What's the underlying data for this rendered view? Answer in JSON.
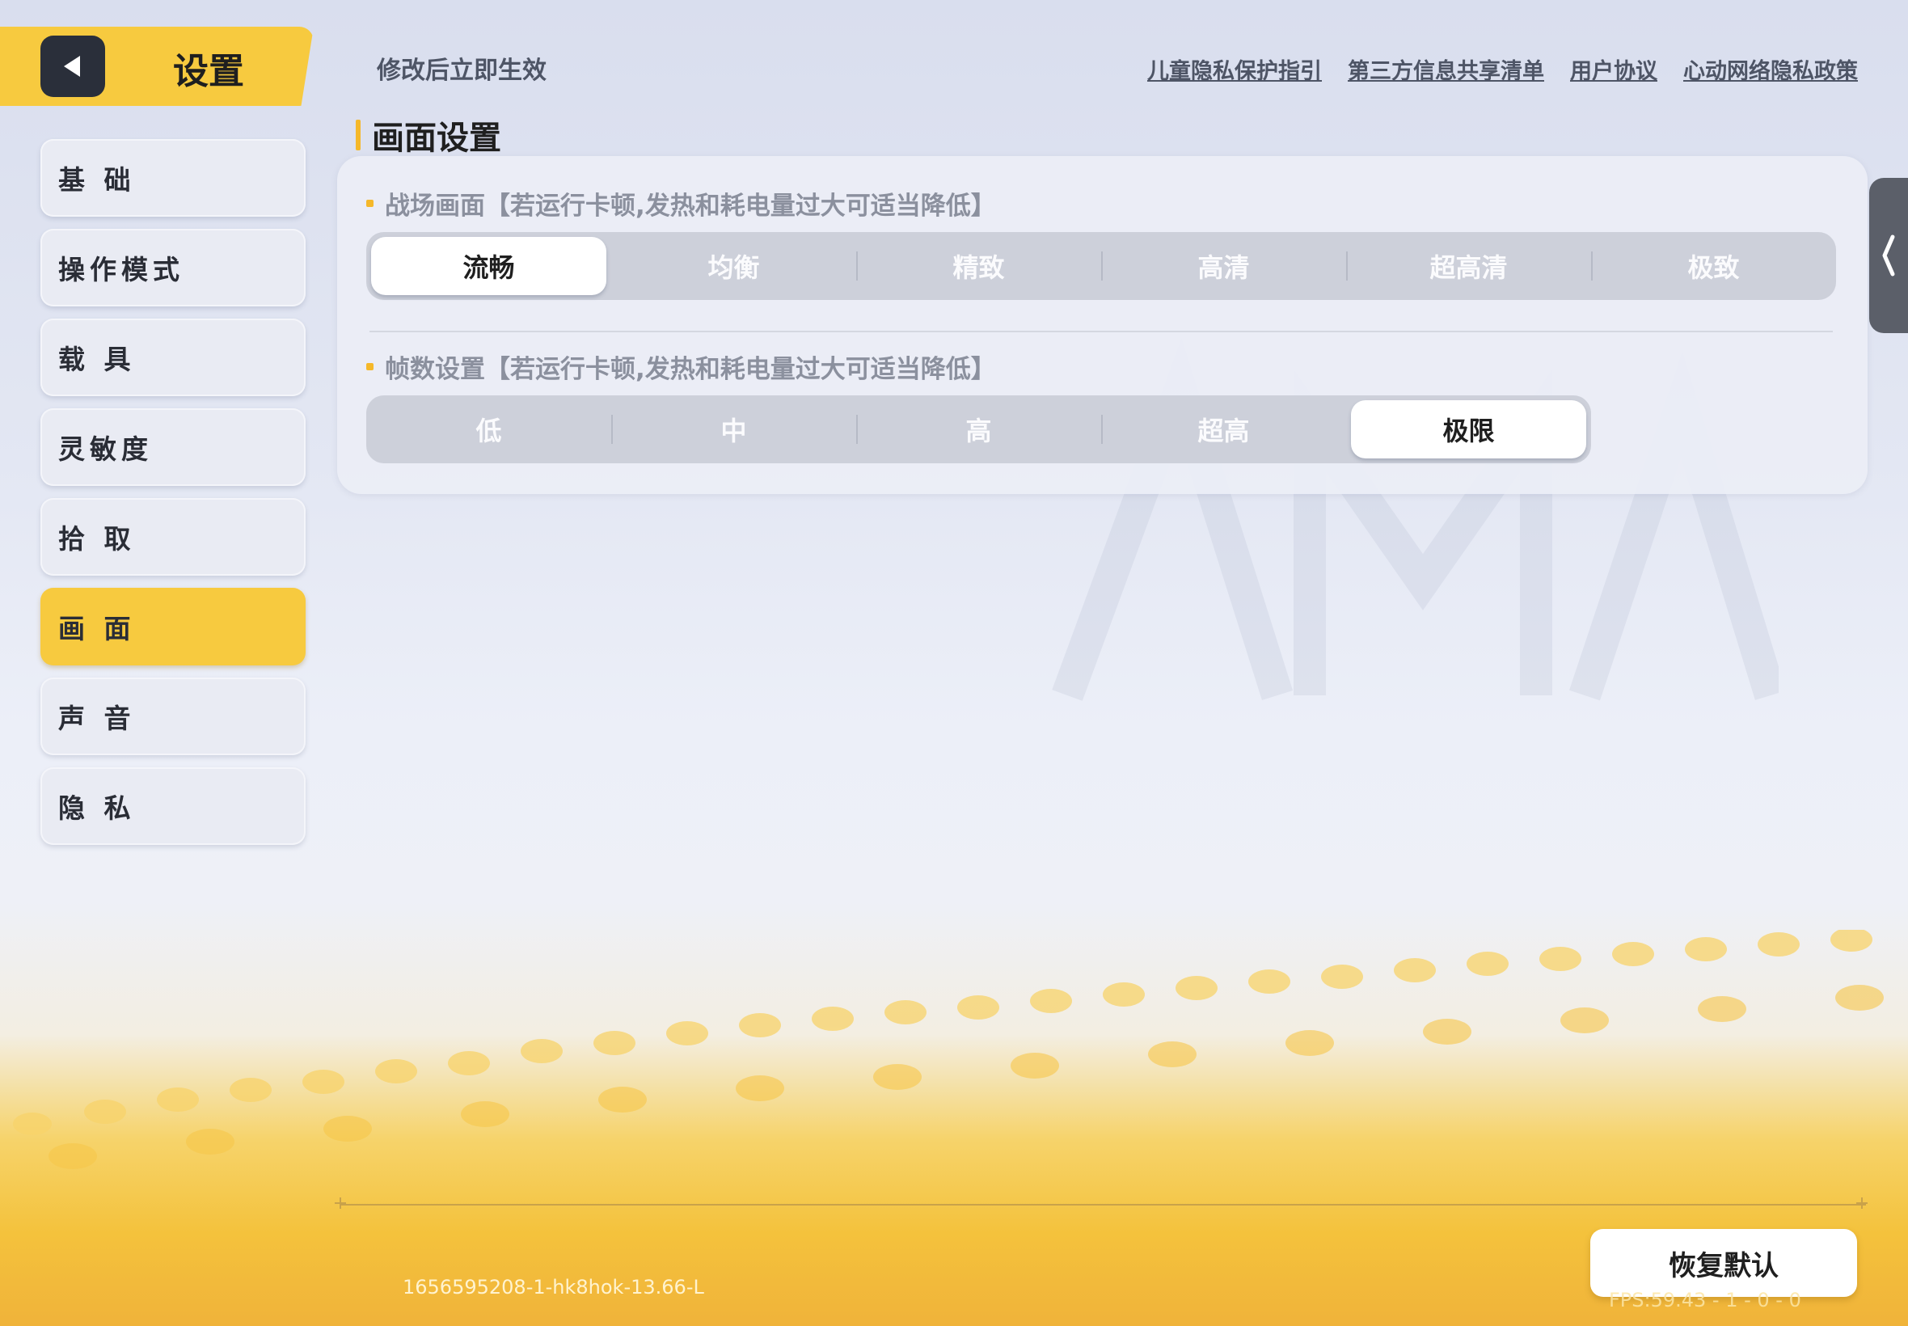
{
  "header": {
    "title": "设置",
    "hint": "修改后立即生效",
    "links": [
      "儿童隐私保护指引",
      "第三方信息共享清单",
      "用户协议",
      "心动网络隐私政策"
    ]
  },
  "sidebar": {
    "items": [
      {
        "label": "基 础"
      },
      {
        "label": "操作模式"
      },
      {
        "label": "载 具"
      },
      {
        "label": "灵敏度"
      },
      {
        "label": "拾 取"
      },
      {
        "label": "画 面",
        "active": true
      },
      {
        "label": "声 音"
      },
      {
        "label": "隐 私"
      }
    ]
  },
  "section": {
    "title": "画面设置",
    "quality": {
      "label": "战场画面【若运行卡顿,发热和耗电量过大可适当降低】",
      "options": [
        "流畅",
        "均衡",
        "精致",
        "高清",
        "超高清",
        "极致"
      ],
      "selected": "流畅"
    },
    "framerate": {
      "label": "帧数设置【若运行卡顿,发热和耗电量过大可适当降低】",
      "options": [
        "低",
        "中",
        "高",
        "超高",
        "极限"
      ],
      "selected": "极限"
    }
  },
  "footer": {
    "restore_label": "恢复默认",
    "version": "1656595208-1-hk8hok-13.66-L",
    "fps": "FPS:59.43 - 1 - 0 - 0"
  },
  "colors": {
    "accent": "#f7ca3f",
    "selected_pill": "#ffffff",
    "segment_bg": "#cdd0da"
  },
  "icons": {
    "back": "back-arrow-icon",
    "drawer": "chevron-left-icon"
  }
}
